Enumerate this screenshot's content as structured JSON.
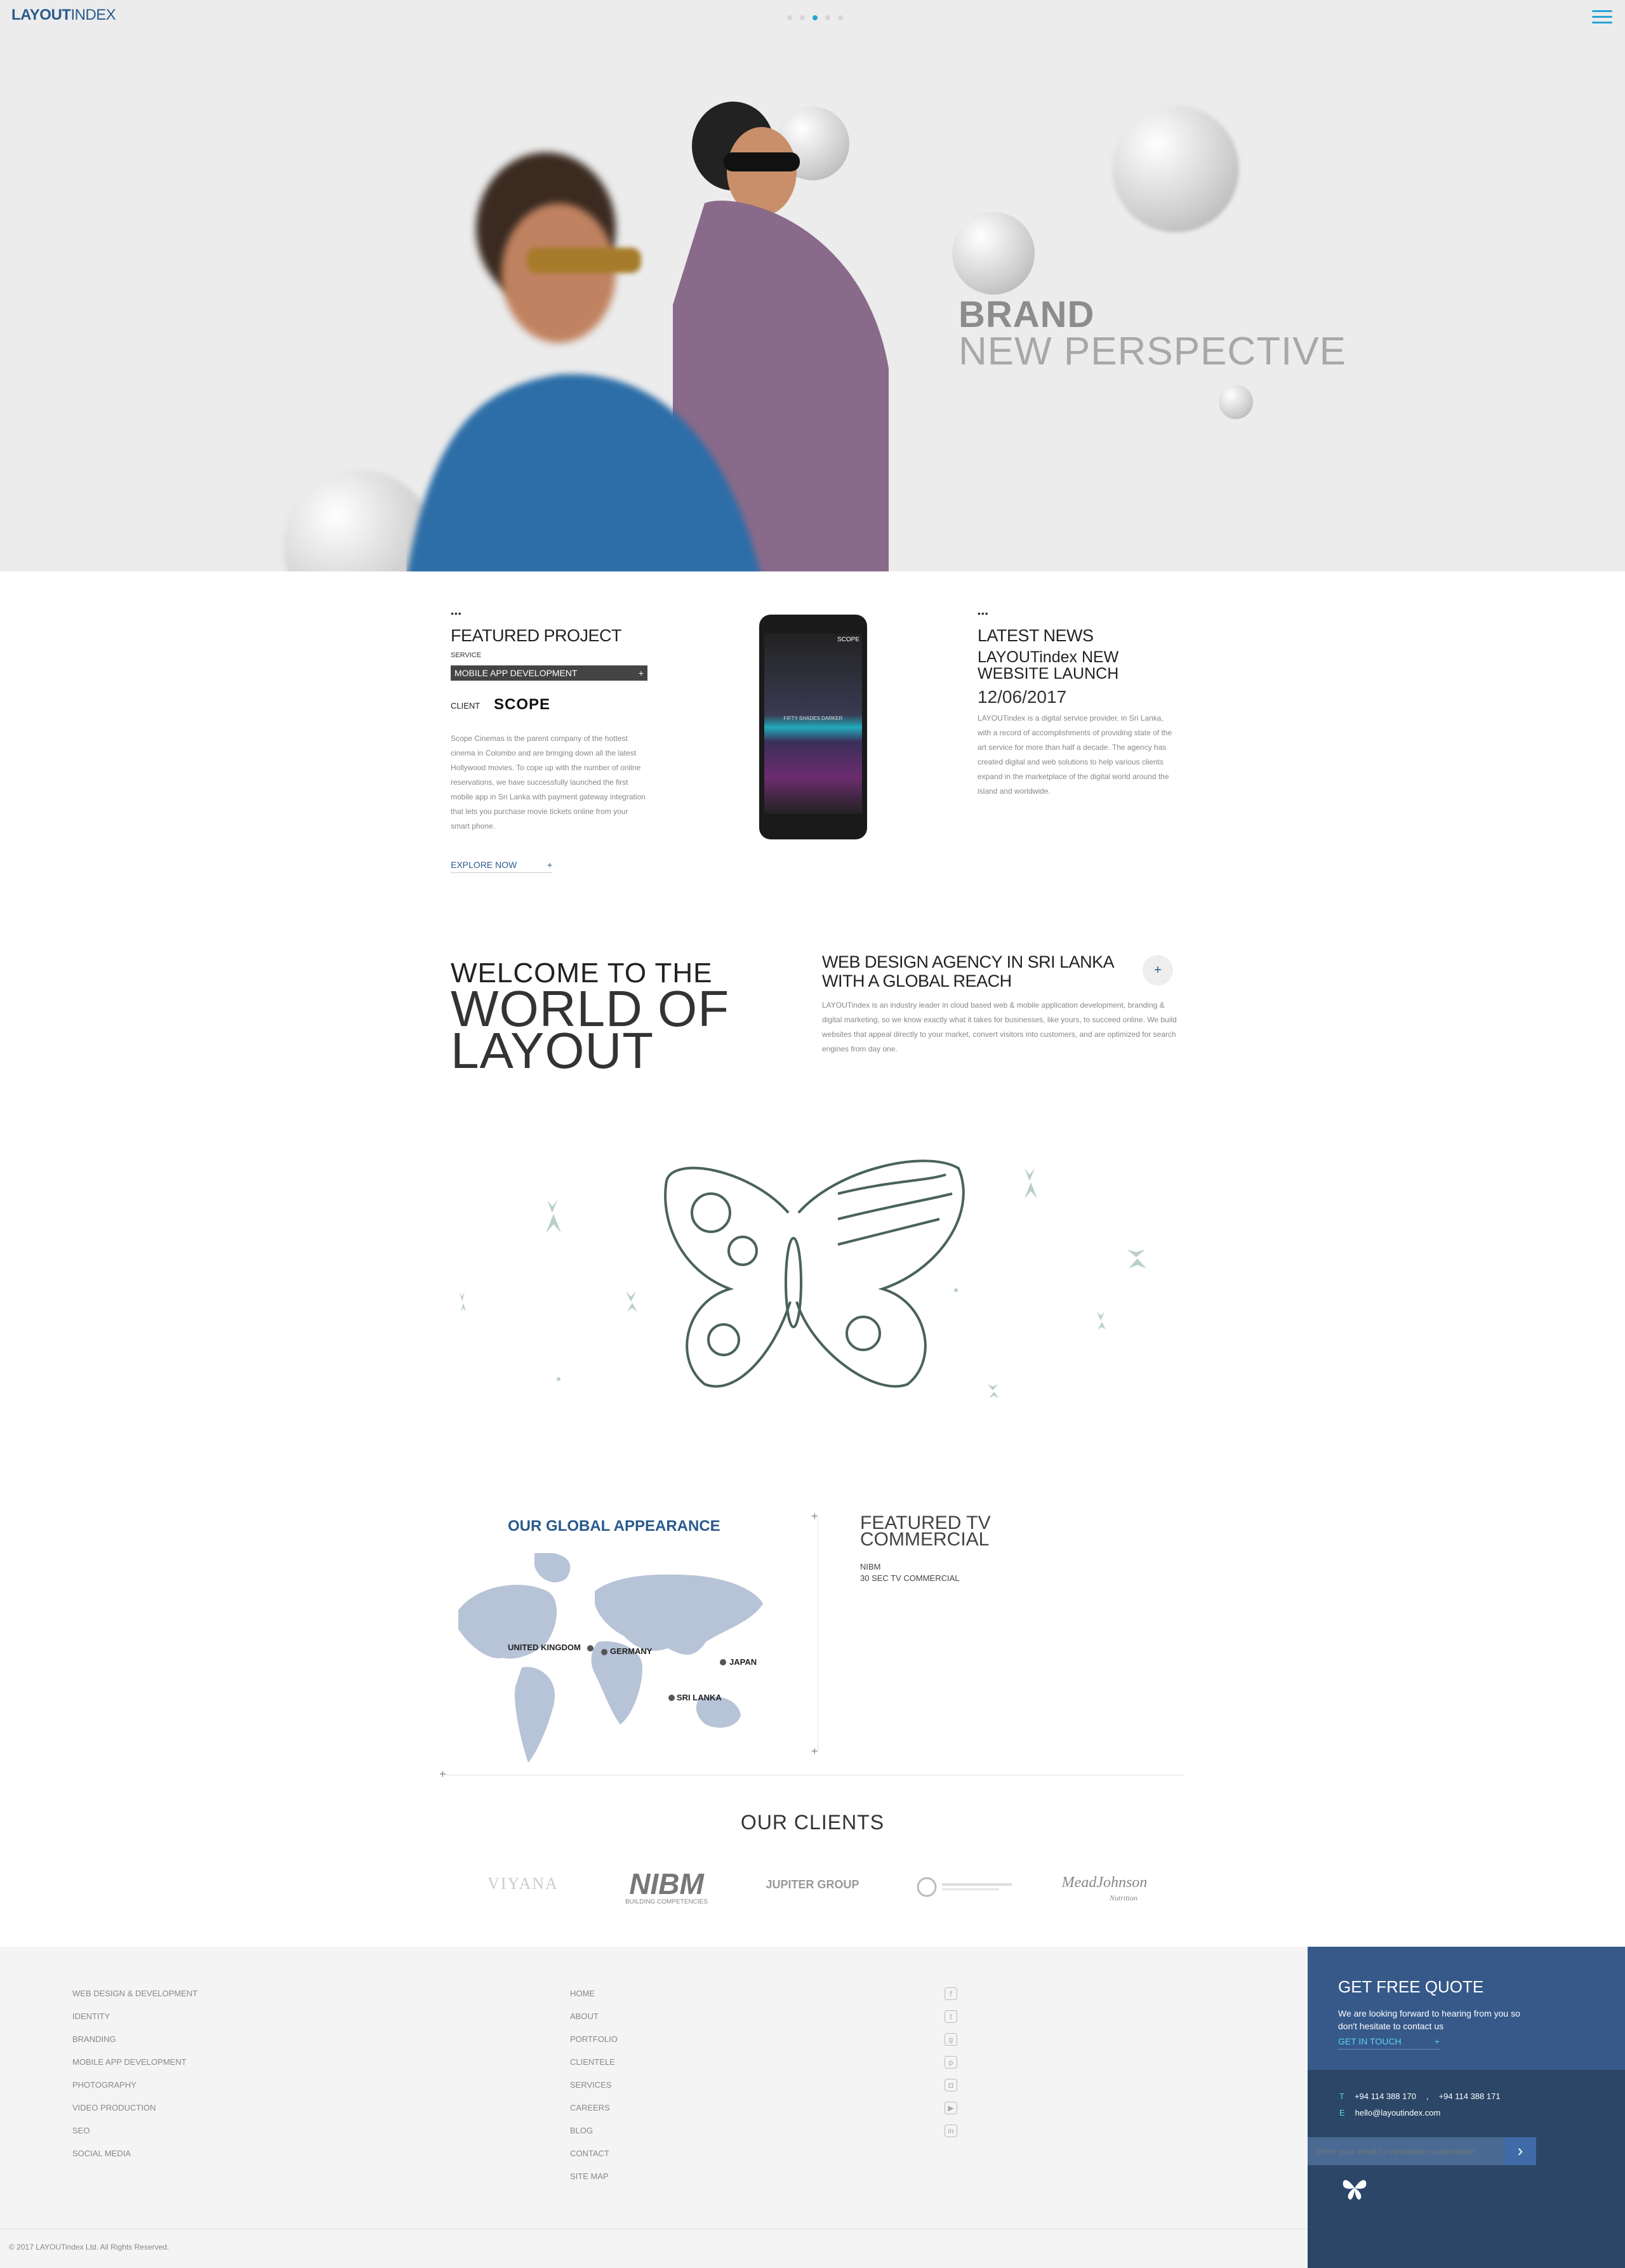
{
  "header": {
    "logo_bold": "LAYOUT",
    "logo_light": "INDEX",
    "menu_icon": "hamburger-menu-icon"
  },
  "hero": {
    "line1": "BRAND",
    "line2": "NEW PERSPECTIVE",
    "slides_total": 5,
    "slide_active": 3
  },
  "featured": {
    "dots": "•••",
    "title": "FEATURED PROJECT",
    "service_label": "SERVICE",
    "service_value": "MOBILE APP DEVELOPMENT",
    "service_plus": "+",
    "client_label": "CLIENT",
    "client_logo": "SCOPE",
    "description": "Scope Cinemas is the parent company of the hottest cinema in Colombo and are bringing down all the latest Hollywood movies. To cope up with the number of online reservations, we have successfully launched the first mobile app in Sri Lanka with payment gateway integration that lets you purchase movie tickets online from your smart phone.",
    "explore_label": "EXPLORE NOW",
    "explore_plus": "+"
  },
  "phone": {
    "brand": "SCOPE",
    "movie": "FIFTY SHADES DARKER"
  },
  "news": {
    "dots": "•••",
    "title": "LATEST NEWS",
    "headline": "LAYOUTindex NEW WEBSITE LAUNCH",
    "date": "12/06/2017",
    "body": "LAYOUTindex is a digital service provider, in Sri Lanka, with a record of accomplishments of providing state of the art service for more than half a decade. The agency has created digital and web solutions to help various clients expand in the marketplace of the digital world around the island and worldwide."
  },
  "welcome": {
    "line1": "WELCOME TO THE",
    "line2": "WORLD OF",
    "line3": "LAYOUT",
    "agency_title": "WEB DESIGN AGENCY IN SRI LANKA WITH A GLOBAL REACH",
    "agency_body": "LAYOUTindex is an industry leader in cloud based web & mobile application development, branding & digital marketing, so we know exactly what it takes for businesses, like yours, to succeed online. We build websites that appeal directly to your market, convert visitors into customers, and are optimized for search engines from day one.",
    "plus": "+"
  },
  "global": {
    "title": "OUR GLOBAL APPEARANCE",
    "locations": [
      "UNITED KINGDOM",
      "GERMANY",
      "JAPAN",
      "SRI LANKA"
    ]
  },
  "tv": {
    "title_line1": "FEATURED TV",
    "title_line2": "COMMERCIAL",
    "client": "NIBM",
    "desc": "30 SEC TV COMMERCIAL",
    "plus": "+"
  },
  "clients": {
    "title": "OUR CLIENTS",
    "logos": [
      "VIYANA",
      "NIBM",
      "JUPITER GROUP",
      "",
      "MeadJohnson"
    ],
    "nibm_sub": "BUILDING COMPETENCIES",
    "mead_sub": "Nutrition"
  },
  "footer": {
    "services": [
      "WEB DESIGN & DEVELOPMENT",
      "IDENTITY",
      "BRANDING",
      "MOBILE APP DEVELOPMENT",
      "PHOTOGRAPHY",
      "VIDEO PRODUCTION",
      "SEO",
      "SOCIAL MEDIA"
    ],
    "pages": [
      "HOME",
      "ABOUT",
      "PORTFOLIO",
      "CLIENTELE",
      "SERVICES",
      "CAREERS",
      "BLOG",
      "CONTACT",
      "SITE MAP"
    ],
    "social": [
      "facebook-icon",
      "twitter-icon",
      "google-plus-icon",
      "pinterest-icon",
      "instagram-icon",
      "youtube-icon",
      "linkedin-icon"
    ],
    "copyright": "© 2017 LAYOUTindex Ltd. All Rights Reserved."
  },
  "quote": {
    "title": "GET FREE QUOTE",
    "body": "We are looking forward to hearing from you so don't hesitate to contact us",
    "cta": "GET IN TOUCH",
    "cta_plus": "+",
    "tel_label": "T",
    "tel1": "+94 114 388 170",
    "tel_sep": ",",
    "tel2": "+94 114 388 171",
    "email_label": "E",
    "email": "hello@layoutindex.com",
    "newsletter_placeholder": "Enter your email for newsletter subscription",
    "submit_icon": "chevron-right-icon"
  },
  "colors": {
    "brand_blue": "#2a5b8c",
    "accent_cyan": "#29a3d6",
    "footer_panel": "#36598a",
    "footer_panel_dark": "#2b4666"
  }
}
